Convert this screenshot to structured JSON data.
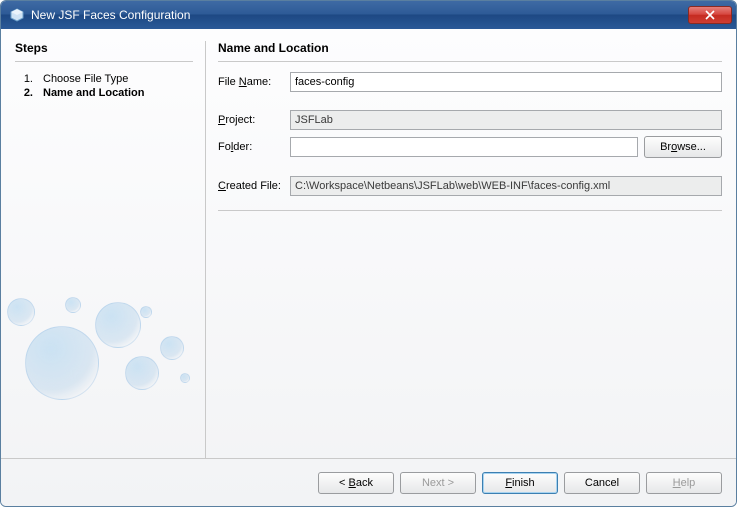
{
  "window": {
    "title": "New JSF Faces Configuration"
  },
  "steps": {
    "heading": "Steps",
    "items": [
      {
        "num": "1.",
        "label": "Choose File Type"
      },
      {
        "num": "2.",
        "label": "Name and Location"
      }
    ]
  },
  "form": {
    "heading": "Name and Location",
    "fileNameLabel": "File Name:",
    "fileNameValue": "faces-config",
    "projectLabel": "Project:",
    "projectValue": "JSFLab",
    "folderLabel": "Folder:",
    "folderValue": "",
    "browseLabel": "Browse...",
    "createdFileLabel": "Created File:",
    "createdFileValue": "C:\\Workspace\\Netbeans\\JSFLab\\web\\WEB-INF\\faces-config.xml"
  },
  "buttons": {
    "back": "< Back",
    "next": "Next >",
    "finish": "Finish",
    "cancel": "Cancel",
    "help": "Help"
  }
}
